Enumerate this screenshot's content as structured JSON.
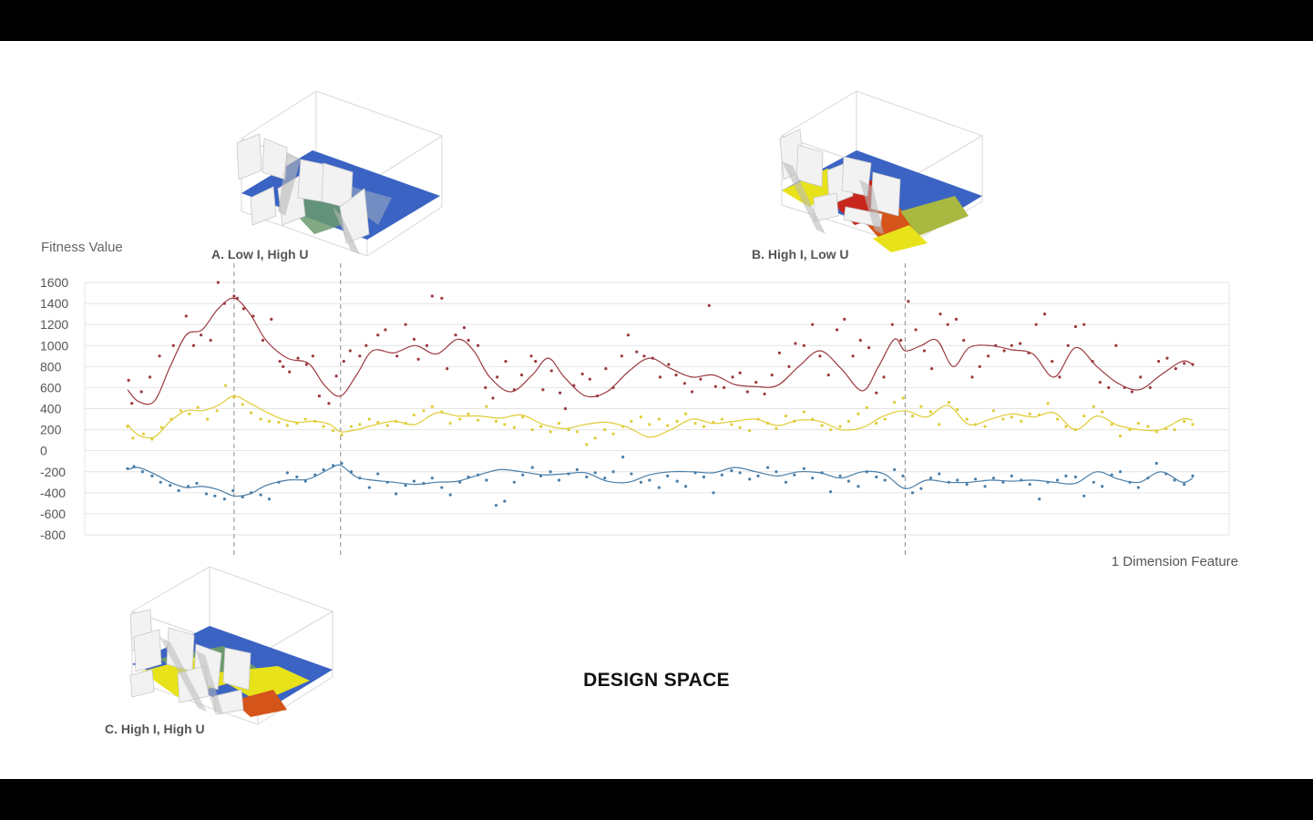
{
  "title": "DESIGN SPACE",
  "cases": [
    {
      "id": "A",
      "label": "A. Low I, High U",
      "marker_x": 10
    },
    {
      "id": "B",
      "label": "B. High I, Low U",
      "marker_x": 73
    },
    {
      "id": "C",
      "label": "C. High I, High U",
      "marker_x": 20
    }
  ],
  "colors": {
    "series_1": "#9b3a3f",
    "series_2": "#e0cc36",
    "series_3": "#4a7ea8",
    "plane_blue": "#3b63c4",
    "plane_yellow": "#e8e21a",
    "plane_red": "#c8261c",
    "plane_orange": "#d4541a",
    "plane_green": "#6b9a6e",
    "plane_olive": "#a8b840"
  },
  "chart_data": {
    "type": "scatter",
    "title": "",
    "xlabel": "1 Dimension Feature",
    "ylabel": "Fitness Value",
    "xlim": [
      0,
      100
    ],
    "ylim": [
      -800,
      1600
    ],
    "yticks": [
      1600,
      1400,
      1200,
      1000,
      800,
      600,
      400,
      200,
      0,
      -200,
      -400,
      -600,
      -800
    ],
    "grid": true,
    "legend": "none",
    "reference_lines_x": [
      10,
      20,
      73
    ],
    "series": [
      {
        "color": "#9b3a3f",
        "trend_x": [
          0,
          1,
          2.5,
          4,
          5.5,
          7,
          8.5,
          10,
          11.5,
          13,
          15,
          17,
          18.5,
          20,
          21.5,
          23,
          25,
          27,
          29,
          31,
          32.5,
          34,
          36,
          38,
          39.5,
          41,
          43,
          45,
          47,
          49,
          51,
          53,
          55,
          57,
          59,
          61,
          63,
          65,
          67,
          69,
          70.5,
          72,
          73,
          74.5,
          76,
          77.5,
          79,
          81,
          83,
          85,
          87,
          89,
          91,
          93,
          95,
          97,
          99,
          100
        ],
        "trend_y": [
          580,
          470,
          470,
          800,
          1100,
          1150,
          1350,
          1450,
          1300,
          1050,
          880,
          830,
          620,
          520,
          720,
          950,
          930,
          1000,
          920,
          1060,
          950,
          700,
          560,
          720,
          880,
          700,
          520,
          560,
          750,
          880,
          780,
          700,
          720,
          630,
          610,
          620,
          800,
          950,
          780,
          570,
          800,
          1060,
          950,
          1000,
          1050,
          800,
          980,
          1000,
          960,
          920,
          700,
          980,
          800,
          640,
          580,
          720,
          850,
          820
        ],
        "points_x": [
          0.1,
          0.4,
          1.3,
          2.1,
          3.0,
          4.3,
          5.5,
          6.2,
          6.9,
          7.8,
          8.5,
          9.1,
          10.0,
          10.3,
          10.9,
          11.8,
          12.7,
          13.5,
          14.3,
          14.6,
          15.2,
          16.0,
          16.8,
          17.4,
          18.0,
          18.9,
          19.6,
          20.3,
          20.9,
          21.8,
          22.4,
          23.5,
          24.2,
          25.3,
          26.1,
          26.9,
          27.3,
          28.1,
          28.6,
          29.5,
          30.0,
          30.8,
          31.6,
          32.0,
          32.9,
          33.6,
          34.3,
          34.7,
          35.5,
          36.3,
          37.0,
          37.9,
          38.3,
          39.0,
          39.8,
          40.6,
          41.1,
          41.9,
          42.7,
          43.4,
          44.1,
          44.9,
          45.6,
          46.4,
          47.0,
          47.8,
          48.5,
          49.3,
          50.0,
          50.8,
          51.5,
          52.3,
          53.0,
          53.8,
          54.6,
          55.2,
          56.0,
          56.8,
          57.5,
          58.2,
          59.0,
          59.8,
          60.5,
          61.2,
          62.1,
          62.7,
          63.5,
          64.3,
          65.0,
          65.8,
          66.6,
          67.3,
          68.1,
          68.8,
          69.6,
          70.3,
          71.0,
          71.8,
          72.6,
          73.3,
          74.0,
          74.8,
          75.5,
          76.3,
          77.0,
          77.8,
          78.5,
          79.3,
          80.0,
          80.8,
          81.5,
          82.3,
          83.0,
          83.8,
          84.6,
          85.3,
          86.1,
          86.8,
          87.5,
          88.3,
          89.0,
          89.8,
          90.6,
          91.3,
          92.1,
          92.8,
          93.6,
          94.3,
          95.1,
          96.0,
          96.8,
          97.6,
          98.4,
          99.2,
          100.0
        ],
        "points_y": [
          670,
          450,
          560,
          700,
          900,
          1000,
          1280,
          1000,
          1100,
          1050,
          1600,
          1400,
          1470,
          1450,
          1350,
          1280,
          1050,
          1250,
          850,
          800,
          750,
          880,
          820,
          900,
          520,
          450,
          710,
          850,
          950,
          900,
          1000,
          1100,
          1150,
          900,
          1200,
          1060,
          870,
          1000,
          1470,
          1450,
          780,
          1100,
          1170,
          1050,
          1000,
          600,
          500,
          700,
          850,
          580,
          720,
          900,
          850,
          580,
          760,
          550,
          400,
          620,
          730,
          680,
          520,
          780,
          600,
          900,
          1100,
          940,
          900,
          880,
          700,
          820,
          720,
          640,
          560,
          680,
          1380,
          610,
          600,
          700,
          740,
          560,
          650,
          540,
          720,
          930,
          800,
          1020,
          1000,
          1200,
          900,
          720,
          1150,
          1250,
          900,
          1050,
          980,
          550,
          700,
          1200,
          1050,
          1420,
          1150,
          950,
          780,
          1300,
          1200,
          1250,
          1050,
          700,
          800,
          900,
          1000,
          950,
          1000,
          1020,
          930,
          1200,
          1300,
          850,
          700,
          1000,
          1180,
          1200,
          850,
          650,
          600,
          1000,
          600,
          560,
          700,
          600,
          850,
          880,
          780,
          830,
          820,
          810
        ]
      },
      {
        "color": "#e0cc36",
        "trend_x": [
          0,
          1,
          2.5,
          4,
          5.5,
          7,
          8.5,
          10,
          11.5,
          13,
          14.5,
          16,
          17.5,
          19,
          20,
          21.5,
          23,
          25,
          27,
          29,
          31,
          33,
          35,
          37,
          39,
          41,
          43,
          45,
          47,
          49,
          51,
          53,
          55,
          57,
          59,
          61,
          63,
          65,
          67,
          69,
          71,
          73,
          75,
          77,
          79,
          81,
          83,
          85,
          87,
          89,
          91,
          93,
          95,
          97,
          99,
          100
        ],
        "trend_y": [
          250,
          150,
          130,
          280,
          380,
          380,
          430,
          520,
          450,
          370,
          300,
          270,
          280,
          250,
          180,
          200,
          240,
          280,
          250,
          360,
          330,
          330,
          310,
          340,
          250,
          210,
          250,
          270,
          220,
          130,
          200,
          300,
          260,
          280,
          300,
          240,
          290,
          280,
          200,
          220,
          330,
          380,
          320,
          430,
          250,
          300,
          350,
          320,
          360,
          200,
          330,
          240,
          200,
          200,
          300,
          290
        ],
        "points_x": [
          0.0,
          0.5,
          1.5,
          2.3,
          3.2,
          4.1,
          5.0,
          5.8,
          6.6,
          7.5,
          8.4,
          9.2,
          10.0,
          10.8,
          11.6,
          12.5,
          13.3,
          14.2,
          15.0,
          15.9,
          16.7,
          17.6,
          18.4,
          19.3,
          20.1,
          21.0,
          21.8,
          22.7,
          23.5,
          24.4,
          25.2,
          26.1,
          26.9,
          27.8,
          28.6,
          29.5,
          30.3,
          31.2,
          32.0,
          32.9,
          33.7,
          34.6,
          35.4,
          36.3,
          37.1,
          38.0,
          38.8,
          39.7,
          40.5,
          41.4,
          42.2,
          43.1,
          43.9,
          44.8,
          45.6,
          46.5,
          47.3,
          48.2,
          49.0,
          49.9,
          50.7,
          51.6,
          52.4,
          53.3,
          54.1,
          55.0,
          55.8,
          56.7,
          57.5,
          58.4,
          59.2,
          60.1,
          60.9,
          61.8,
          62.6,
          63.5,
          64.3,
          65.2,
          66.0,
          66.9,
          67.7,
          68.6,
          69.4,
          70.3,
          71.1,
          72.0,
          72.8,
          73.7,
          74.5,
          75.4,
          76.2,
          77.1,
          77.9,
          78.8,
          79.6,
          80.5,
          81.3,
          82.2,
          83.0,
          83.9,
          84.7,
          85.6,
          86.4,
          87.3,
          88.1,
          89.0,
          89.8,
          90.7,
          91.5,
          92.4,
          93.2,
          94.1,
          94.9,
          95.8,
          96.6,
          97.5,
          98.3,
          99.2,
          100.0
        ],
        "points_y": [
          230,
          120,
          160,
          110,
          220,
          300,
          380,
          350,
          410,
          300,
          380,
          620,
          510,
          440,
          360,
          300,
          280,
          270,
          240,
          260,
          300,
          280,
          230,
          190,
          150,
          230,
          250,
          300,
          270,
          240,
          280,
          260,
          340,
          380,
          420,
          370,
          260,
          300,
          350,
          290,
          420,
          280,
          250,
          220,
          320,
          200,
          230,
          180,
          260,
          200,
          180,
          60,
          120,
          200,
          160,
          230,
          280,
          320,
          250,
          300,
          240,
          280,
          350,
          260,
          230,
          270,
          300,
          250,
          220,
          190,
          300,
          260,
          210,
          330,
          280,
          370,
          300,
          240,
          200,
          230,
          280,
          350,
          410,
          260,
          300,
          460,
          500,
          330,
          420,
          370,
          250,
          460,
          390,
          300,
          250,
          230,
          380,
          300,
          320,
          280,
          350,
          340,
          450,
          300,
          230,
          200,
          330,
          420,
          370,
          250,
          140,
          200,
          260,
          230,
          180,
          210,
          200,
          280,
          250,
          310,
          280
        ]
      },
      {
        "color": "#4a7ea8",
        "trend_x": [
          0,
          1,
          2.5,
          4,
          5.5,
          7,
          8.5,
          10,
          11.5,
          13,
          15,
          17,
          19,
          20,
          21.5,
          23,
          25,
          27,
          29,
          31,
          33,
          35,
          37,
          39,
          41,
          43,
          45,
          47,
          49,
          51,
          53,
          55,
          57,
          59,
          61,
          63,
          65,
          67,
          69,
          71,
          73,
          75,
          77,
          79,
          81,
          83,
          85,
          87,
          89,
          91,
          93,
          95,
          97,
          99,
          100
        ],
        "trend_y": [
          -180,
          -160,
          -220,
          -300,
          -350,
          -340,
          -370,
          -430,
          -410,
          -330,
          -280,
          -270,
          -170,
          -140,
          -250,
          -280,
          -300,
          -320,
          -300,
          -290,
          -230,
          -180,
          -200,
          -230,
          -220,
          -210,
          -290,
          -300,
          -230,
          -200,
          -200,
          -210,
          -160,
          -200,
          -240,
          -200,
          -210,
          -260,
          -200,
          -220,
          -360,
          -280,
          -300,
          -300,
          -280,
          -290,
          -280,
          -300,
          -310,
          -200,
          -270,
          -300,
          -200,
          -300,
          -260
        ],
        "points_x": [
          0.0,
          0.6,
          1.4,
          2.3,
          3.1,
          4.0,
          4.8,
          5.7,
          6.5,
          7.4,
          8.2,
          9.1,
          9.9,
          10.8,
          11.6,
          12.5,
          13.3,
          14.2,
          15.0,
          15.9,
          16.7,
          17.6,
          18.4,
          19.3,
          20.1,
          21.0,
          21.8,
          22.7,
          23.5,
          24.4,
          25.2,
          26.1,
          26.9,
          27.8,
          28.6,
          29.5,
          30.3,
          31.2,
          32.0,
          32.9,
          33.7,
          34.6,
          35.4,
          36.3,
          37.1,
          38.0,
          38.8,
          39.7,
          40.5,
          41.4,
          42.2,
          43.1,
          43.9,
          44.8,
          45.6,
          46.5,
          47.3,
          48.2,
          49.0,
          49.9,
          50.7,
          51.6,
          52.4,
          53.3,
          54.1,
          55.0,
          55.8,
          56.7,
          57.5,
          58.4,
          59.2,
          60.1,
          60.9,
          61.8,
          62.6,
          63.5,
          64.3,
          65.2,
          66.0,
          66.9,
          67.7,
          68.6,
          69.4,
          70.3,
          71.1,
          72.0,
          72.8,
          73.7,
          74.5,
          75.4,
          76.2,
          77.1,
          77.9,
          78.8,
          79.6,
          80.5,
          81.3,
          82.2,
          83.0,
          83.9,
          84.7,
          85.6,
          86.4,
          87.3,
          88.1,
          89.0,
          89.8,
          90.7,
          91.5,
          92.4,
          93.2,
          94.1,
          94.9,
          95.8,
          96.6,
          97.5,
          98.3,
          99.2,
          100.0
        ],
        "points_y": [
          -170,
          -150,
          -200,
          -240,
          -300,
          -330,
          -380,
          -340,
          -310,
          -410,
          -430,
          -460,
          -380,
          -440,
          -400,
          -420,
          -460,
          -300,
          -210,
          -250,
          -290,
          -230,
          -180,
          -140,
          -120,
          -200,
          -260,
          -350,
          -220,
          -300,
          -410,
          -330,
          -290,
          -310,
          -260,
          -350,
          -420,
          -300,
          -250,
          -230,
          -280,
          -520,
          -480,
          -300,
          -230,
          -160,
          -240,
          -200,
          -280,
          -220,
          -180,
          -250,
          -210,
          -260,
          -200,
          -60,
          -220,
          -300,
          -280,
          -350,
          -240,
          -290,
          -340,
          -210,
          -250,
          -400,
          -230,
          -190,
          -210,
          -270,
          -240,
          -160,
          -200,
          -300,
          -230,
          -170,
          -260,
          -210,
          -390,
          -240,
          -290,
          -340,
          -200,
          -250,
          -280,
          -180,
          -240,
          -400,
          -360,
          -260,
          -220,
          -300,
          -280,
          -320,
          -270,
          -340,
          -260,
          -300,
          -240,
          -280,
          -320,
          -460,
          -300,
          -280,
          -240,
          -250,
          -430,
          -300,
          -340,
          -230,
          -200,
          -300,
          -350,
          -260,
          -120,
          -220,
          -280,
          -320,
          -240,
          -300,
          -270
        ]
      }
    ]
  }
}
